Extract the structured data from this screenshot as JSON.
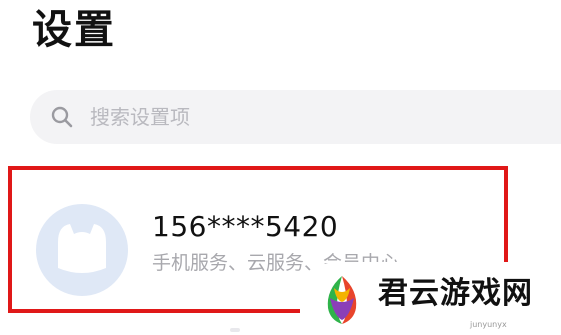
{
  "page": {
    "title": "设置"
  },
  "search": {
    "placeholder": "搜索设置项",
    "icon": "search-icon"
  },
  "account": {
    "phone": "156****5420",
    "subtitle": "手机服务、云服务、会员中心",
    "avatar_icon": "avatar-icon",
    "highlight_color": "#e01818"
  },
  "watermark": {
    "text": "君云游戏网",
    "domain": "junyunyx"
  }
}
